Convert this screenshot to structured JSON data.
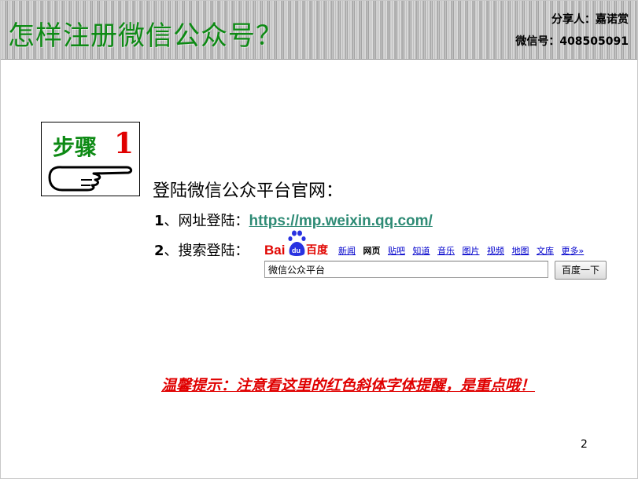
{
  "header": {
    "title": "怎样注册微信公众号？",
    "sharer": "分享人：嘉诺赏",
    "wechat_id": "微信号：408505091"
  },
  "step": {
    "label": "步骤",
    "number": "1"
  },
  "content": {
    "heading": "登陆微信公众平台官网：",
    "item1_num": "1",
    "item1_label": "、网址登陆：",
    "item1_link": "https://mp.weixin.qq.com/",
    "item2_num": "2",
    "item2_label": "、搜索登陆："
  },
  "baidu": {
    "logo_left": "Bai",
    "logo_right": "百度",
    "paw_text": "du",
    "nav": [
      "新闻",
      "网页",
      "贴吧",
      "知道",
      "音乐",
      "图片",
      "视频",
      "地图",
      "文库",
      "更多»"
    ],
    "active_nav": "网页",
    "search_value": "微信公众平台",
    "search_button": "百度一下"
  },
  "tip": "温馨提示：注意看这里的红色斜体字体提醒，是重点哦！",
  "page_number": "2",
  "colors": {
    "title_green": "#0d8a14",
    "step_red": "#e00000",
    "link_teal": "#2e8b75",
    "tip_red": "#e00000",
    "baidu_blue": "#2932e1",
    "baidu_red": "#e10602"
  }
}
